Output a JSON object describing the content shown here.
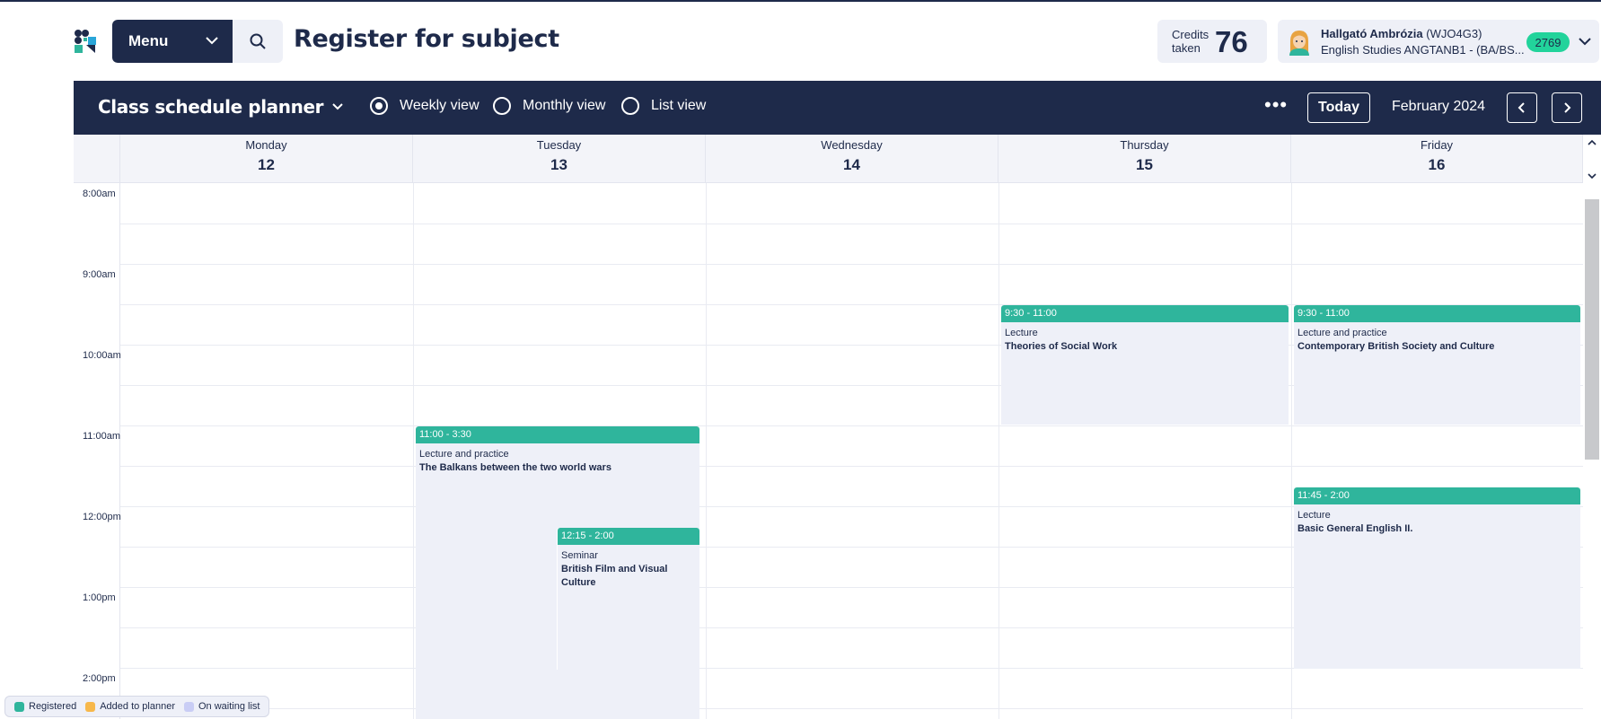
{
  "header": {
    "menu_label": "Menu",
    "page_title": "Register for subject",
    "credits_label": "Credits taken",
    "credits_value": "76",
    "user_name": "Hallgató Ambrózia",
    "user_code": "(WJO4G3)",
    "user_program": "English Studies ANGTANB1 - (BA/BS...",
    "user_badge": "2769"
  },
  "toolbar": {
    "planner_title": "Class schedule planner",
    "views": [
      "Weekly view",
      "Monthly view",
      "List view"
    ],
    "selected_view": "Weekly view",
    "more_label": "•••",
    "today_label": "Today",
    "month_label": "February 2024"
  },
  "days": [
    {
      "name": "Monday",
      "num": "12"
    },
    {
      "name": "Tuesday",
      "num": "13"
    },
    {
      "name": "Wednesday",
      "num": "14"
    },
    {
      "name": "Thursday",
      "num": "15"
    },
    {
      "name": "Friday",
      "num": "16"
    }
  ],
  "times": [
    "8:00am",
    "9:00am",
    "10:00am",
    "11:00am",
    "12:00pm",
    "1:00pm",
    "2:00pm"
  ],
  "events": [
    {
      "time": "9:30 - 11:00",
      "type": "Lecture",
      "name": "Theories of Social Work"
    },
    {
      "time": "9:30 - 11:00",
      "type": "Lecture and practice",
      "name": "Contemporary British Society and Culture"
    },
    {
      "time": "11:00 - 3:30",
      "type": "Lecture and practice",
      "name": "The Balkans between the two world wars"
    },
    {
      "time": "12:15 - 2:00",
      "type": "Seminar",
      "name": "British Film and Visual Culture"
    },
    {
      "time": "11:45 - 2:00",
      "type": "Lecture",
      "name": "Basic General English II."
    }
  ],
  "legend": [
    {
      "label": "Registered",
      "color": "#2fb59c"
    },
    {
      "label": "Added to planner",
      "color": "#f7b84b"
    },
    {
      "label": "On waiting list",
      "color": "#c9cdf5"
    }
  ],
  "colors": {
    "primary": "#1e2a4a",
    "registered": "#2fb59c",
    "badge": "#22d39b"
  }
}
